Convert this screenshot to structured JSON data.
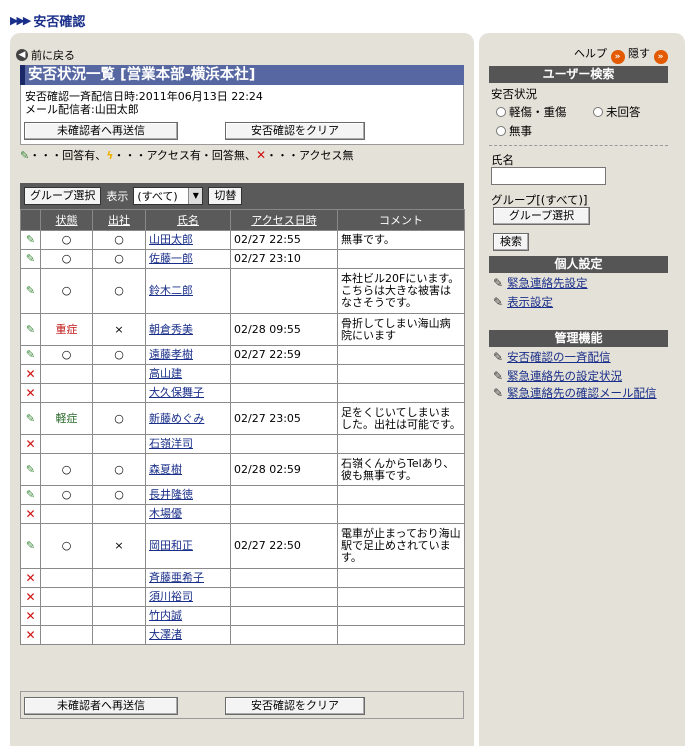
{
  "header": {
    "title": "安否確認",
    "arrows": "▶▶▶"
  },
  "nav": {
    "back": "前に戻る"
  },
  "main": {
    "title": "安否状況一覧 [営業本部-横浜本社]",
    "delivered_label": "安否確認一斉配信日時:",
    "delivered_value": "2011年06月13日 22:24",
    "sender_label": "メール配信者:",
    "sender_value": "山田太郎",
    "resend_button": "未確認者へ再送信",
    "clear_button": "安否確認をクリア"
  },
  "legend": {
    "answered": "・・・回答有、",
    "no_answer": "・・・アクセス有・回答無、",
    "no_access": "・・・アクセス無"
  },
  "toolbar": {
    "group_select": "グループ選択",
    "display_label": "表示",
    "display_value": "(すべて)",
    "switch": "切替"
  },
  "table": {
    "headers": [
      "状態",
      "出社",
      "氏名",
      "アクセス日時",
      "コメント"
    ],
    "rows": [
      {
        "mark": "ok",
        "status": "○",
        "office": "○",
        "name": "山田太郎",
        "access": "02/27 22:55",
        "comment": "無事です。"
      },
      {
        "mark": "ok",
        "status": "○",
        "office": "○",
        "name": "佐藤一郎",
        "access": "02/27 23:10",
        "comment": ""
      },
      {
        "mark": "ok",
        "status": "○",
        "office": "○",
        "name": "鈴木二郎",
        "access": "",
        "comment": "本社ビル20Fにいます。こちらは大きな被害はなさそうです。"
      },
      {
        "mark": "ok",
        "status": "重症",
        "office": "×",
        "name": "朝倉秀美",
        "access": "02/28 09:55",
        "comment": "骨折してしまい海山病院にいます"
      },
      {
        "mark": "ok",
        "status": "○",
        "office": "○",
        "name": "遠藤孝樹",
        "access": "02/27 22:59",
        "comment": ""
      },
      {
        "mark": "x",
        "status": "",
        "office": "",
        "name": "高山建",
        "access": "",
        "comment": ""
      },
      {
        "mark": "x",
        "status": "",
        "office": "",
        "name": "大久保舞子",
        "access": "",
        "comment": ""
      },
      {
        "mark": "ok",
        "status": "軽症",
        "office": "○",
        "name": "新藤めぐみ",
        "access": "02/27 23:05",
        "comment": "足をくじいてしまいました。出社は可能です。"
      },
      {
        "mark": "x",
        "status": "",
        "office": "",
        "name": "石嶺洋司",
        "access": "",
        "comment": ""
      },
      {
        "mark": "ok",
        "status": "○",
        "office": "○",
        "name": "森夏樹",
        "access": "02/28 02:59",
        "comment": "石嶺くんからTelあり、彼も無事です。"
      },
      {
        "mark": "ok",
        "status": "○",
        "office": "○",
        "name": "長井隆徳",
        "access": "",
        "comment": ""
      },
      {
        "mark": "x",
        "status": "",
        "office": "",
        "name": "木場優",
        "access": "",
        "comment": ""
      },
      {
        "mark": "ok",
        "status": "○",
        "office": "×",
        "name": "岡田和正",
        "access": "02/27 22:50",
        "comment": "電車が止まっており海山駅で足止めされています。"
      },
      {
        "mark": "x",
        "status": "",
        "office": "",
        "name": "斉藤亜希子",
        "access": "",
        "comment": ""
      },
      {
        "mark": "x",
        "status": "",
        "office": "",
        "name": "須川裕司",
        "access": "",
        "comment": ""
      },
      {
        "mark": "x",
        "status": "",
        "office": "",
        "name": "竹内誠",
        "access": "",
        "comment": ""
      },
      {
        "mark": "x",
        "status": "",
        "office": "",
        "name": "大澤渚",
        "access": "",
        "comment": ""
      }
    ]
  },
  "sidebar": {
    "help": "ヘルプ",
    "hide": "隠す",
    "user_search": "ユーザー検索",
    "safety_status": "安否状況",
    "opt_injury": "軽傷・重傷",
    "opt_unanswered": "未回答",
    "opt_safe": "無事",
    "name_label": "氏名",
    "name_value": "",
    "group_label": "グループ[(すべて)]",
    "group_button": "グループ選択",
    "search_button": "検索",
    "personal": "個人設定",
    "personal_items": [
      "緊急連絡先設定",
      "表示設定"
    ],
    "admin": "管理機能",
    "admin_items": [
      "安否確認の一斉配信",
      "緊急連絡先の設定状況",
      "緊急連絡先の確認メール配信"
    ]
  },
  "colors": {
    "accent": "#1a2f8a",
    "title_bar": "#5667a1",
    "panel": "#e4e1d8",
    "danger": "#d01010",
    "ok": "#3a8a3a"
  }
}
